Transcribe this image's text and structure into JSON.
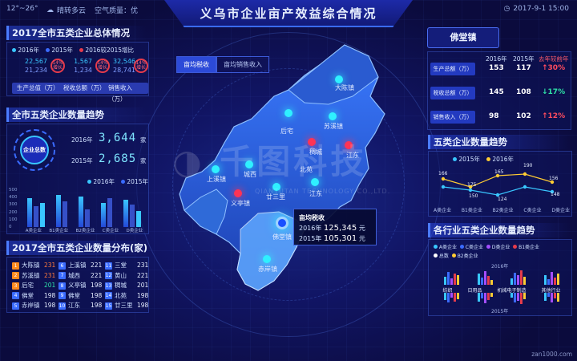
{
  "topbar": {
    "temp": "12°~26°",
    "weather": "晴转多云",
    "air": "空气质量：优",
    "datetime": "2017-9-1 15:00"
  },
  "title": "义乌市企业亩产效益综合情况",
  "overall": {
    "title": "2017全市五类企业总体情况",
    "legend": [
      "2016年",
      "2015年",
      "2016较2015增比"
    ],
    "rows": [
      {
        "a": "22,567",
        "b": "21,234",
        "c": "1,567",
        "d": "1,234",
        "e": "32,546",
        "f": "28,741"
      }
    ],
    "badges": [
      "14% 增长",
      "14% 增长",
      "14% 增长"
    ],
    "labels": [
      "生产总值（万）",
      "税收总额（万）",
      "销售收入（万）"
    ]
  },
  "trend": {
    "title": "全市五类企业数量趋势",
    "center_label": "企业总数",
    "y2016_label": "2016年",
    "y2016": "3,644",
    "y2015_label": "2015年",
    "y2015": "2,685",
    "unit": "家",
    "legend": [
      "2016年",
      "2015年"
    ],
    "y_ticks": [
      "500",
      "400",
      "300",
      "200",
      "100",
      "0"
    ],
    "categories": [
      "A类企业",
      "B1类企业",
      "B2类企业",
      "C类企业",
      "D类企业"
    ]
  },
  "distribution": {
    "title": "2017全市五类企业数量分布(家)",
    "items": [
      {
        "rank": "1",
        "name": "大陈镇",
        "val": "231"
      },
      {
        "rank": "2",
        "name": "苏溪镇",
        "val": "231"
      },
      {
        "rank": "3",
        "name": "后宅",
        "val": "201"
      },
      {
        "rank": "4",
        "name": "佛堂",
        "val": "198"
      },
      {
        "rank": "5",
        "name": "赤岸镇",
        "val": "198"
      },
      {
        "rank": "6",
        "name": "上溪镇",
        "val": "221"
      },
      {
        "rank": "7",
        "name": "城西",
        "val": "221"
      },
      {
        "rank": "8",
        "name": "义亭镇",
        "val": "198"
      },
      {
        "rank": "9",
        "name": "佛堂",
        "val": "198"
      },
      {
        "rank": "10",
        "name": "江东",
        "val": "198"
      },
      {
        "rank": "11",
        "name": "三堂",
        "val": "231"
      },
      {
        "rank": "12",
        "name": "黄山",
        "val": "221"
      },
      {
        "rank": "13",
        "name": "稠城",
        "val": "201"
      },
      {
        "rank": "14",
        "name": "北苑",
        "val": "198"
      },
      {
        "rank": "15",
        "name": "廿三里",
        "val": "198"
      }
    ]
  },
  "map": {
    "tabs": [
      "亩均税收",
      "亩均销售收入"
    ],
    "labels": [
      "大陈镇",
      "后宅",
      "苏溪镇",
      "稠城",
      "江东",
      "城西",
      "上溪镇",
      "廿三里",
      "江东",
      "义亭镇",
      "佛堂镇",
      "赤岸镇",
      "北苑"
    ],
    "tooltip": {
      "title": "亩均税收",
      "l1": "2016年",
      "v1": "125,345",
      "l2": "2015年",
      "v2": "105,301",
      "unit": "元"
    }
  },
  "town": {
    "name": "佛堂镇",
    "headers": [
      "2016年",
      "2015年",
      "去年较前年"
    ],
    "rows": [
      {
        "label": "生产总额（万）",
        "v16": "153",
        "v15": "117",
        "chg": "30%",
        "dir": "up"
      },
      {
        "label": "税收总额（万）",
        "v16": "145",
        "v15": "108",
        "chg": "17%",
        "dir": "down"
      },
      {
        "label": "销售收入（万）",
        "v16": "98",
        "v15": "102",
        "chg": "12%",
        "dir": "up"
      }
    ]
  },
  "line_trend": {
    "title": "五类企业数量趋势",
    "legend": [
      "2015年",
      "2016年"
    ],
    "labels_top": [
      "166",
      "175",
      "190",
      "156"
    ],
    "labels_bot": [
      "165",
      "150",
      "124",
      "148"
    ],
    "categories": [
      "A类企业",
      "B1类企业",
      "B2类企业",
      "C类企业",
      "D类企业"
    ]
  },
  "industry": {
    "title": "各行业五类企业数量趋势",
    "legend": [
      "A类企业",
      "C类企业",
      "D类企业",
      "B1类企业",
      "总数",
      "B2类企业"
    ],
    "year_top": "2016年",
    "year_bot": "2015年",
    "categories": [
      "纺织",
      "日用品",
      "机械电子制造",
      "其他行业"
    ]
  },
  "colors": {
    "accent": "#3a6bff",
    "red": "#e53b4b",
    "green": "#2fe3a8",
    "cyan": "#39c6ff"
  },
  "watermark": "千图科技",
  "watermark_sub": "QIANTUTAN TECHNOLOGY CO.,LTD.",
  "footer": "zan1000.com"
}
